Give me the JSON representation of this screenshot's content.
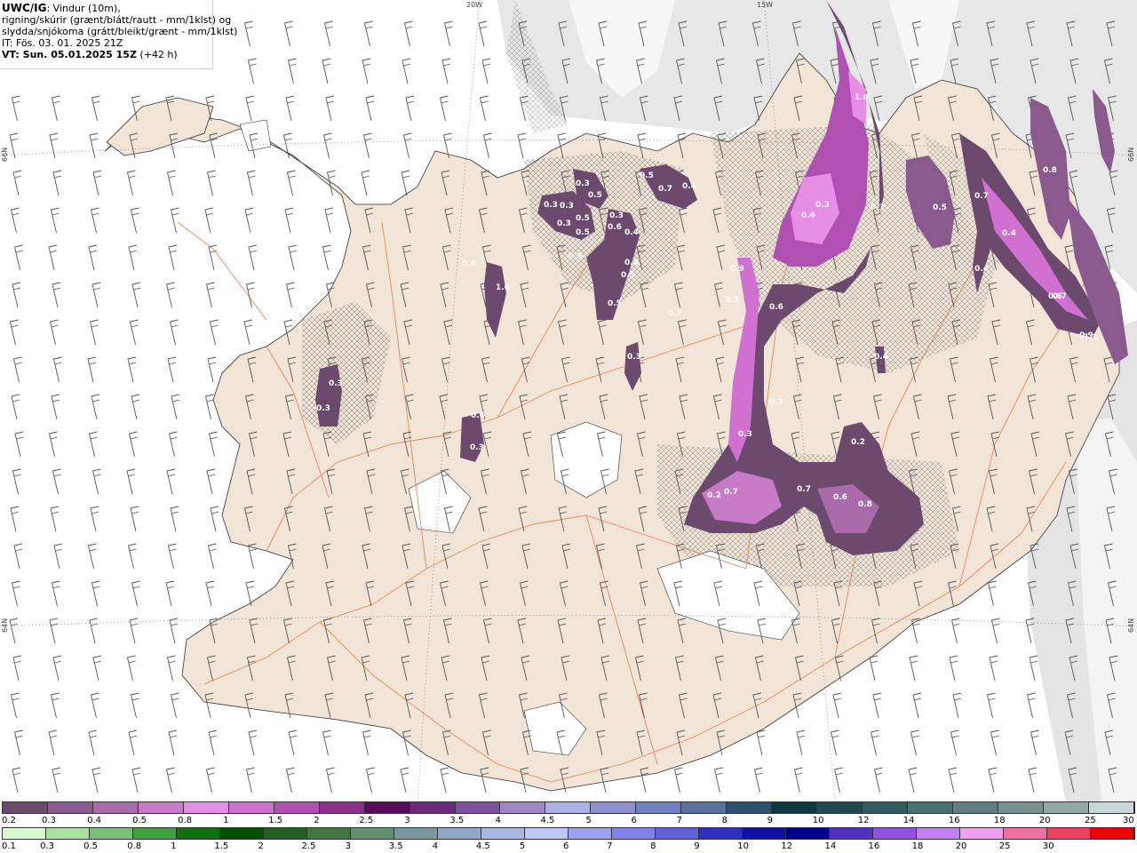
{
  "info": {
    "title": "UWC/IG",
    "line1": ": Vindur (10m),",
    "line2": "rigning/skúrir (grænt/blátt/rautt - mm/1klst) og",
    "line3": "slydda/snjókoma (grátt/bleikt/grænt - mm/1klst)",
    "it": "IT: Fös. 03. 01. 2025 21Z",
    "vt_main": "VT: Sun. 05.01.2025 15Z",
    "vt_extra": " (+42 h)"
  },
  "gridlabels": {
    "lon_20w": "20W",
    "lon_15w": "15W",
    "lat_66n_left": "66N",
    "lat_66n_right": "66N",
    "lat_64n_left": "64N",
    "lat_64n_right": "64N"
  },
  "precip_labels": [
    "1.0",
    "0.8",
    "0.7",
    "0.3",
    "0.4",
    "0.3",
    "0.5",
    "0.4",
    "0.4",
    "0.6",
    "0.9",
    "0.9",
    "0.3",
    "0.6",
    "0.7",
    "1.1",
    "0.3",
    "0.3",
    "0.3",
    "0.3",
    "0.5",
    "0.5",
    "0.5",
    "0.3",
    "0.6",
    "0.4",
    "0.4",
    "0.5",
    "0.5",
    "0.5",
    "0.7",
    "0.4",
    "0.7",
    "1.0",
    "0.3",
    "0.3",
    "0.6",
    "0.3",
    "0.3",
    "0.4",
    "0.2",
    "0.2",
    "0.3",
    "0.7",
    "0.2",
    "0.7",
    "0.6",
    "0.8",
    "0.4",
    "0.5"
  ],
  "colorbar_snow": {
    "labels": [
      "0.2",
      "0.3",
      "0.4",
      "0.5",
      "0.8",
      "1",
      "1.5",
      "2",
      "2.5",
      "3",
      "3.5",
      "4",
      "4.5",
      "5",
      "6",
      "7",
      "8",
      "9",
      "10",
      "12",
      "14",
      "16",
      "18",
      "20",
      "25",
      "30"
    ],
    "colors": [
      "#6b4a6e",
      "#8a5a8e",
      "#a86aa8",
      "#c77ac6",
      "#e68ee6",
      "#d070d0",
      "#b050b0",
      "#8a308a",
      "#5a0a5a",
      "#6a2a7a",
      "#8050a0",
      "#a088c8",
      "#b0b0e8",
      "#9090d0",
      "#7080c0",
      "#5870a0",
      "#305070",
      "#0a3a40",
      "#204a50",
      "#305a60",
      "#4a7070",
      "#608080",
      "#789090",
      "#90a8a8",
      "#c8d8d8"
    ]
  },
  "colorbar_rain": {
    "labels": [
      "0.1",
      "0.3",
      "0.5",
      "0.8",
      "1",
      "1.5",
      "2",
      "2.5",
      "3",
      "3.5",
      "4",
      "4.5",
      "5",
      "6",
      "7",
      "8",
      "9",
      "10",
      "12",
      "14",
      "16",
      "18",
      "20",
      "25",
      "30"
    ],
    "colors": [
      "#d8f8d0",
      "#a8e0a0",
      "#78c078",
      "#40a040",
      "#107010",
      "#005000",
      "#206020",
      "#407840",
      "#609070",
      "#7898a0",
      "#90a8c8",
      "#a8b8e0",
      "#c0c8f8",
      "#a0a0f0",
      "#8080e8",
      "#6060d8",
      "#3030c0",
      "#1010a8",
      "#000090",
      "#5030c0",
      "#9050e0",
      "#c080f0",
      "#f0a0f0",
      "#f070a0",
      "#f04060",
      "#f00000"
    ]
  },
  "colors": {
    "land": "#f2e4d6",
    "road": "#e07a4a",
    "wind": "#555555"
  }
}
